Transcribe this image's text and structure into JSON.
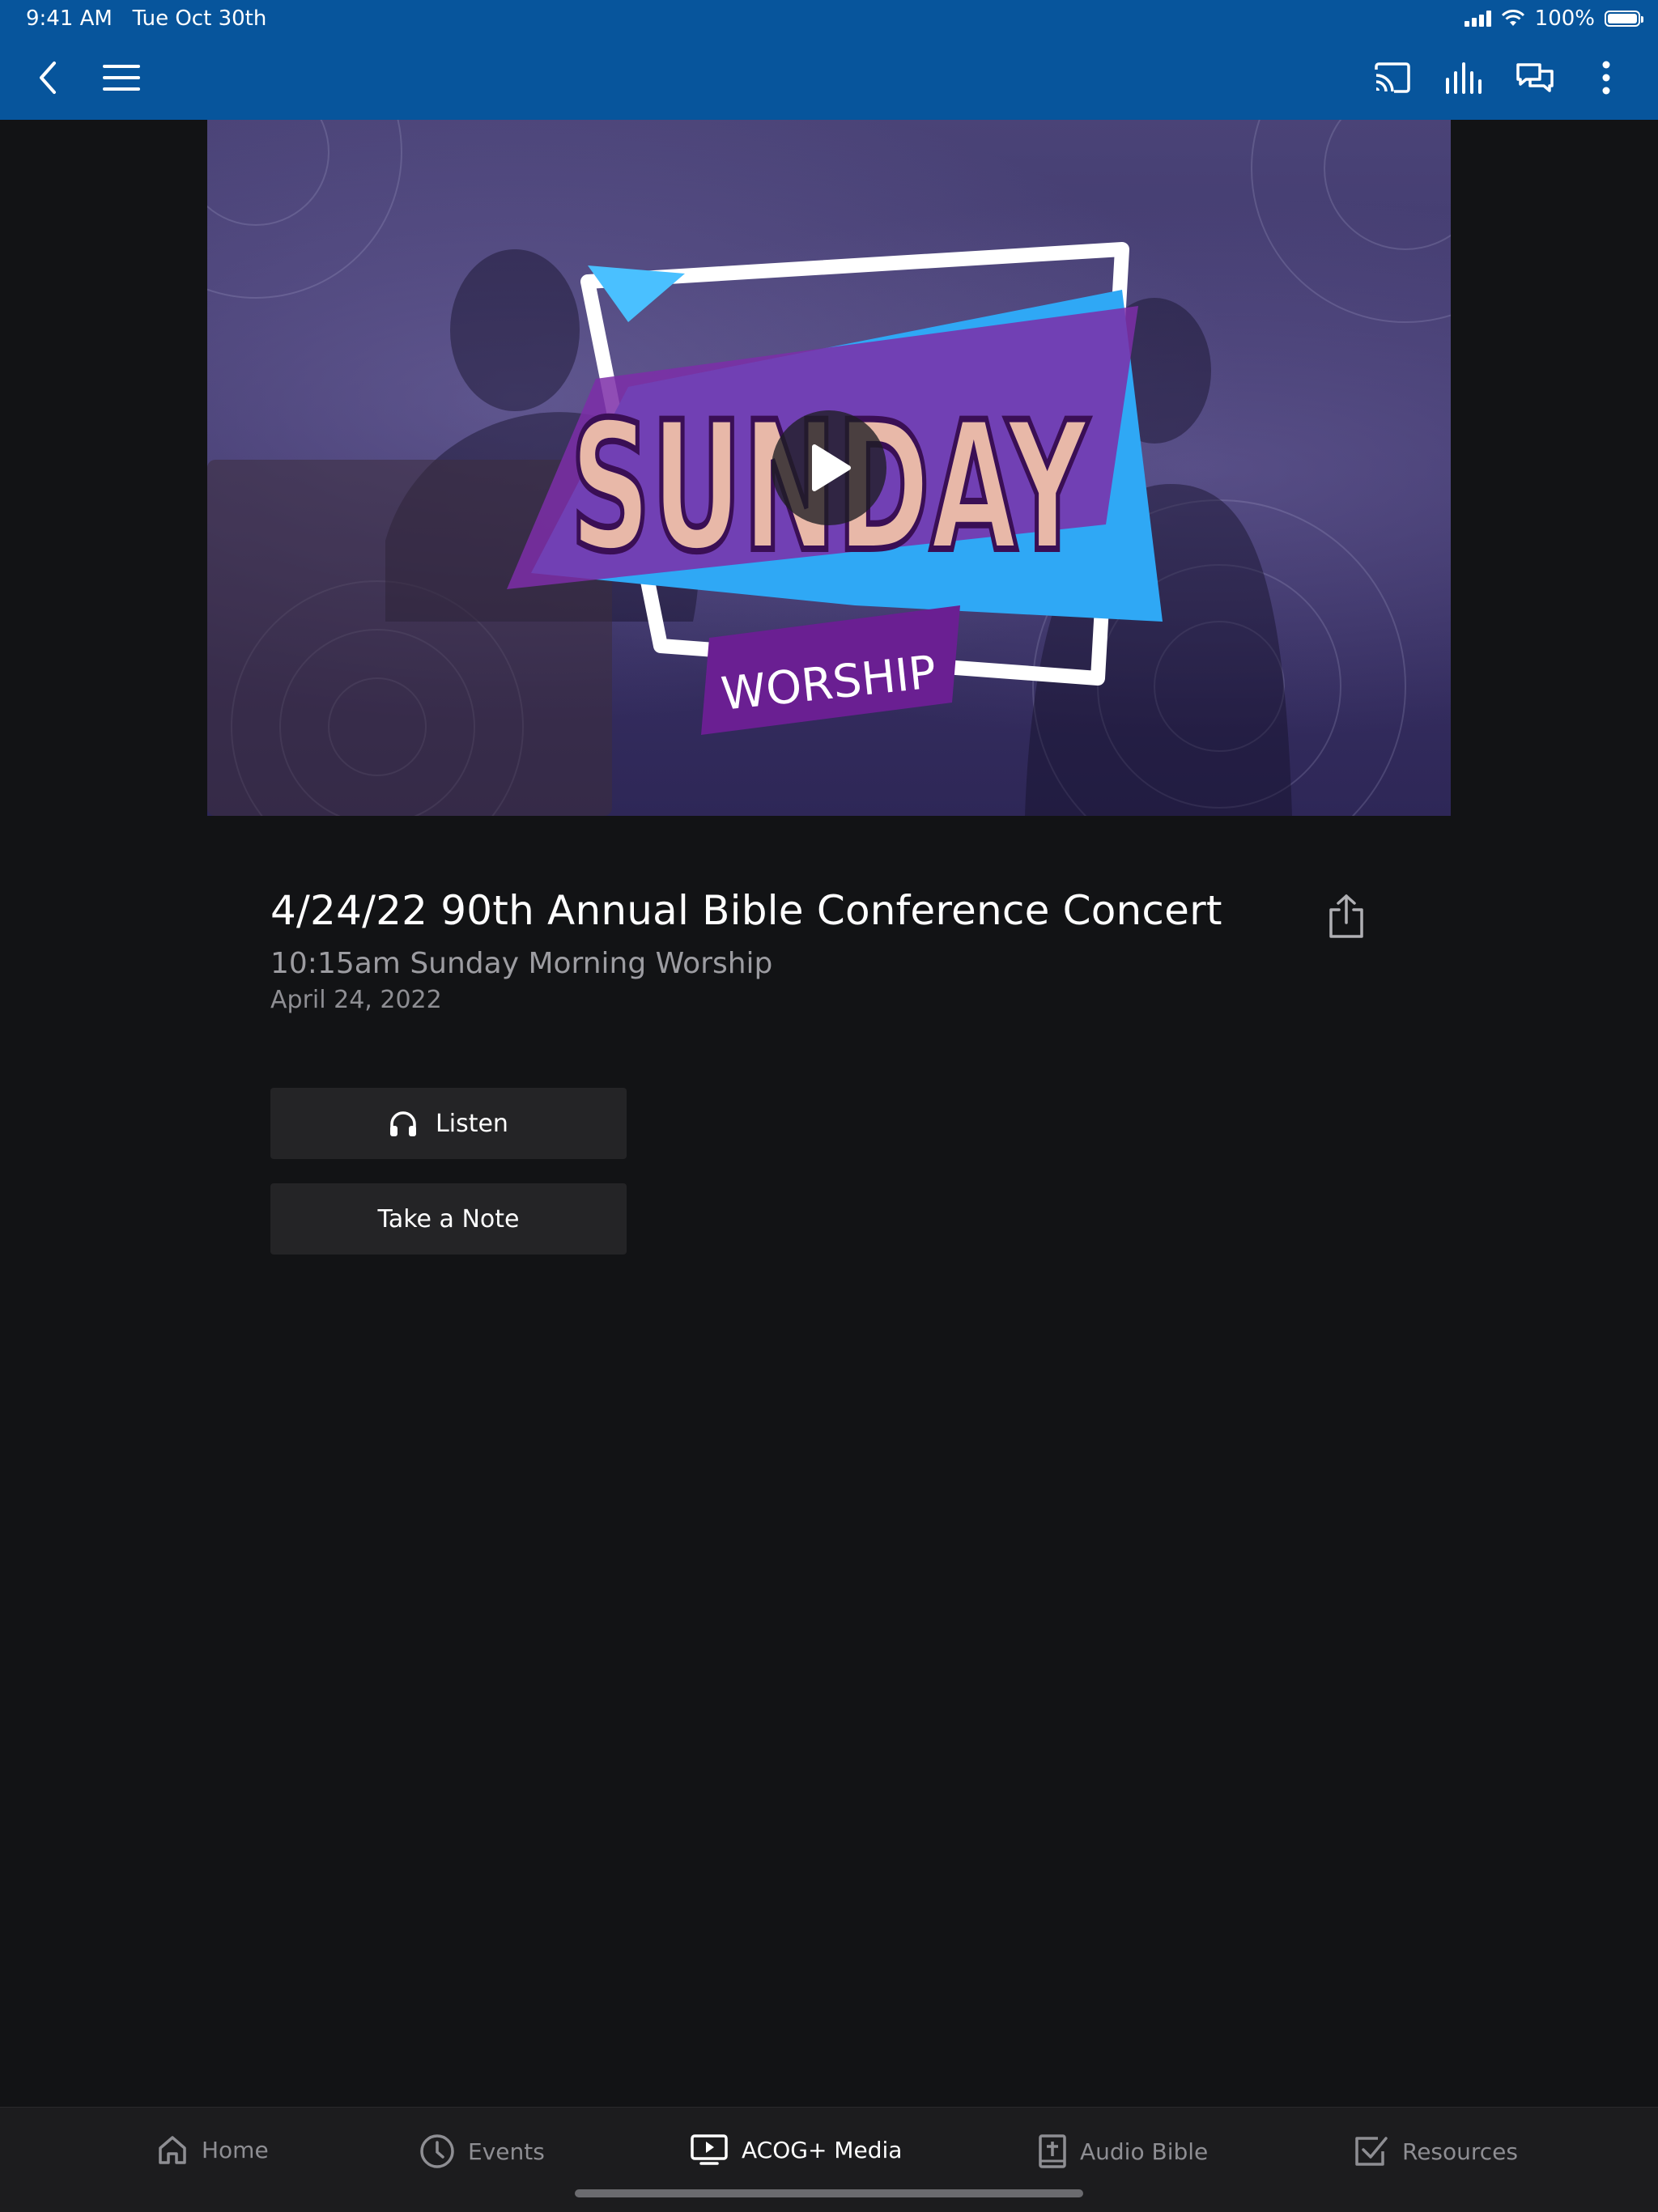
{
  "status_bar": {
    "time": "9:41 AM",
    "date": "Tue Oct 30th",
    "battery": "100%"
  },
  "nav": {
    "icons": [
      "back-icon",
      "menu-icon",
      "cast-icon",
      "audio-levels-icon",
      "chat-icon",
      "more-vert-icon"
    ]
  },
  "hero": {
    "icons": [
      "play-icon"
    ],
    "artwork_text": {
      "main": "SUNDAY",
      "sub": "WORSHIP"
    },
    "colors": {
      "accent_blue": "#2fa8f5",
      "accent_purple": "#7d2ea8"
    }
  },
  "media": {
    "title": "4/24/22 90th Annual Bible Conference Concert",
    "subtitle": "10:15am Sunday Morning Worship",
    "date": "April 24, 2022"
  },
  "actions": {
    "listen_label": "Listen",
    "note_label": "Take a Note"
  },
  "tabs": [
    {
      "label": "Home",
      "icon": "home-icon",
      "active": false
    },
    {
      "label": "Events",
      "icon": "clock-icon",
      "active": false
    },
    {
      "label": "ACOG+ Media",
      "icon": "tv-play-icon",
      "active": true
    },
    {
      "label": "Audio Bible",
      "icon": "bible-icon",
      "active": false
    },
    {
      "label": "Resources",
      "icon": "checkbox-icon",
      "active": false
    }
  ],
  "colors": {
    "nav_bar": "#07559c",
    "background": "#121315",
    "button": "#242426",
    "tab_bar": "#1c1c1e"
  }
}
